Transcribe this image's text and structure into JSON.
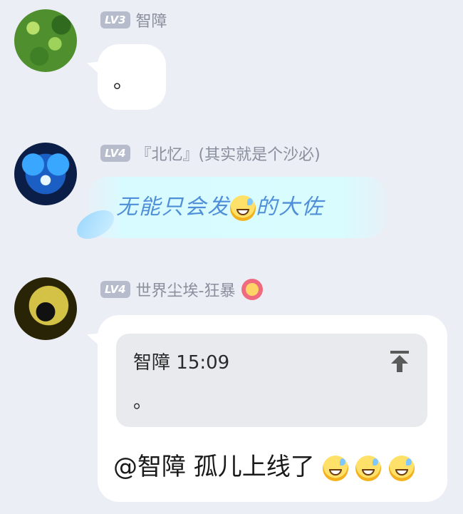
{
  "messages": [
    {
      "level": "LV3",
      "name": "智障",
      "text": "。"
    },
    {
      "level": "LV4",
      "name": "『北忆』(其实就是个沙必)",
      "fancy_text_before": "无能只会发",
      "emoji": "sweat-smile",
      "fancy_text_after": "的大佐"
    },
    {
      "level": "LV4",
      "name": "世界尘埃-狂暴",
      "name_badge_icon": "flower-smile-icon",
      "quote": {
        "author": "智障",
        "time": "15:09",
        "text": "。"
      },
      "text": "@智障 孤儿上线了"
    }
  ],
  "colors": {
    "background": "#eceef5",
    "level_badge": "#b6bccb",
    "fancy_text": "#4f8fd8"
  }
}
